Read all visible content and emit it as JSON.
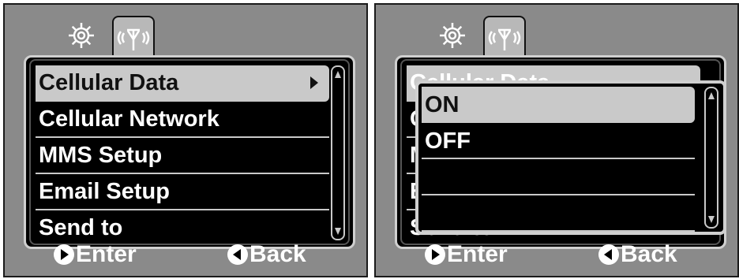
{
  "left_screen": {
    "menu_items": [
      "Cellular Data",
      "Cellular Network",
      "MMS Setup",
      "Email Setup",
      "Send to"
    ],
    "selected_index": 0,
    "footer": {
      "enter": "Enter",
      "back": "Back"
    }
  },
  "right_screen": {
    "options": [
      "ON",
      "OFF",
      "",
      ""
    ],
    "selected_index": 0,
    "footer": {
      "enter": "Enter",
      "back": "Back"
    }
  },
  "icons": {
    "tab1": "gear-icon",
    "tab2": "antenna-icon",
    "enter": "right-arrow-circle-icon",
    "back": "left-arrow-circle-icon"
  }
}
